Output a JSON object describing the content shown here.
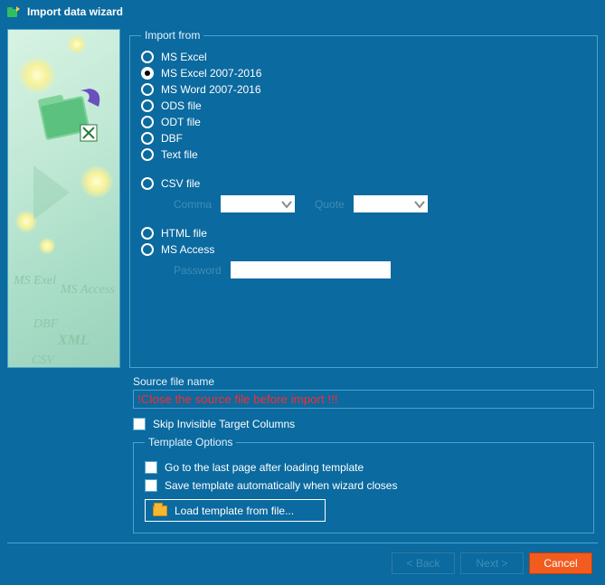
{
  "title": "Import data wizard",
  "importFrom": {
    "legend": "Import from",
    "options": {
      "msexcel": "MS Excel",
      "msexcel2007": "MS Excel 2007-2016",
      "msword2007": "MS Word 2007-2016",
      "ods": "ODS file",
      "odt": "ODT file",
      "dbf": "DBF",
      "text": "Text file",
      "csv": "CSV file",
      "html": "HTML file",
      "msaccess": "MS Access"
    },
    "selected": "msexcel2007",
    "csv": {
      "commaLabel": "Comma",
      "quoteLabel": "Quote"
    },
    "access": {
      "passwordLabel": "Password",
      "passwordValue": ""
    }
  },
  "sourceFile": {
    "label": "Source file name",
    "value": "!Close the source file before import !!!"
  },
  "skipInvisible": {
    "label": "Skip Invisible Target Columns"
  },
  "templateOptions": {
    "legend": "Template Options",
    "gotoLast": "Go to the last page after loading template",
    "saveAuto": "Save template automatically when wizard closes",
    "loadBtn": "Load template from file..."
  },
  "footer": {
    "back": "< Back",
    "next": "Next >",
    "cancel": "Cancel"
  }
}
